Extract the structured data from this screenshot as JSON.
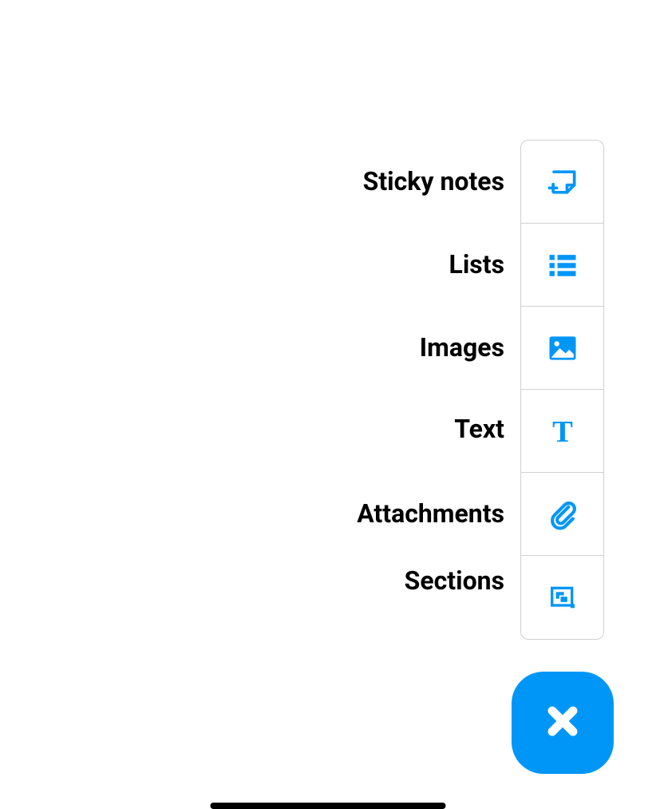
{
  "accent_color": "#0096f7",
  "menu": {
    "items": [
      {
        "label": "Sticky notes",
        "icon": "sticky-note-icon"
      },
      {
        "label": "Lists",
        "icon": "list-icon"
      },
      {
        "label": "Images",
        "icon": "image-icon"
      },
      {
        "label": "Text",
        "icon": "text-icon"
      },
      {
        "label": "Attachments",
        "icon": "attachment-icon"
      },
      {
        "label": "Sections",
        "icon": "sections-icon"
      }
    ]
  },
  "fab": {
    "icon": "close-icon"
  }
}
